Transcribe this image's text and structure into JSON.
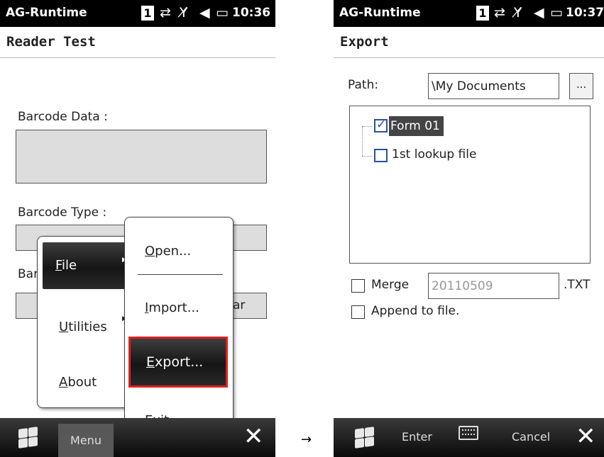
{
  "left_screen": {
    "status": {
      "app_name": "AG-Runtime",
      "badge": "1",
      "time": "10:36"
    },
    "title": "Reader Test",
    "labels": {
      "barcode_data": "Barcode Data :",
      "barcode_type": "Barcode Type :",
      "third_label_partial": "Bar",
      "button_partial": "ar"
    },
    "main_menu": {
      "items": [
        {
          "key": "F",
          "rest": "ile",
          "has_submenu": true
        },
        {
          "key": "U",
          "rest": "tilities",
          "has_submenu": true
        },
        {
          "key": "A",
          "rest": "bout",
          "has_submenu": false
        }
      ]
    },
    "file_submenu": {
      "items": [
        {
          "key": "O",
          "rest": "pen..."
        },
        {
          "key": "I",
          "rest": "mport..."
        },
        {
          "key": "E",
          "rest": "xport..."
        },
        {
          "pre": "E",
          "key": "x",
          "rest": "it"
        }
      ],
      "highlight_color": "#e02020"
    },
    "bottom_bar": {
      "menu_label": "Menu"
    }
  },
  "right_screen": {
    "status": {
      "app_name": "AG-Runtime",
      "badge": "1",
      "time": "10:37"
    },
    "title": "Export",
    "path": {
      "label": "Path:",
      "value": "\\My Documents",
      "browse_label": "..."
    },
    "tree_items": [
      {
        "label": "Form 01",
        "checked": true
      },
      {
        "label": "1st lookup file",
        "checked": false
      }
    ],
    "merge": {
      "label": "Merge",
      "value": "20110509",
      "extension": ".TXT",
      "checked": false
    },
    "append": {
      "label": "Append to file.",
      "checked": false
    },
    "bottom_bar": {
      "enter_label": "Enter",
      "cancel_label": "Cancel"
    }
  },
  "transition_arrow": "→"
}
